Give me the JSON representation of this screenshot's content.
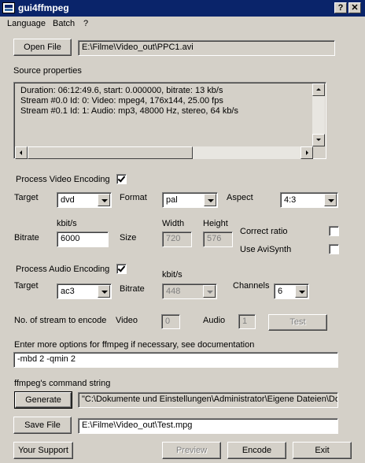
{
  "window": {
    "title": "gui4ffmpeg",
    "help_glyph": "?",
    "close_glyph": "✕"
  },
  "menu": {
    "items": [
      "Language",
      "Batch",
      "?"
    ]
  },
  "input": {
    "open_label": "Open File",
    "path": "E:\\Filme\\Video_out\\PPC1.avi"
  },
  "source": {
    "heading": "Source properties",
    "lines": [
      "Duration: 06:12:49.6, start: 0.000000, bitrate: 13 kb/s",
      "Stream #0.0  Id:   0: Video: mpeg4, 176x144, 25.00 fps",
      "Stream #0.1  Id:   1: Audio: mp3, 48000 Hz, stereo, 64 kb/s"
    ]
  },
  "video": {
    "process_label": "Process Video Encoding",
    "process_checked": true,
    "target_label": "Target",
    "target_value": "dvd",
    "format_label": "Format",
    "format_value": "pal",
    "aspect_label": "Aspect",
    "aspect_value": "4:3",
    "kbits_label": "kbit/s",
    "bitrate_label": "Bitrate",
    "bitrate_value": "6000",
    "size_label": "Size",
    "width_label": "Width",
    "width_value": "720",
    "height_label": "Height",
    "height_value": "576",
    "correct_ratio_label": "Correct ratio",
    "correct_ratio_checked": false,
    "avisynth_label": "Use AviSynth",
    "avisynth_checked": false
  },
  "audio": {
    "process_label": "Process Audio Encoding",
    "process_checked": true,
    "target_label": "Target",
    "target_value": "ac3",
    "kbits_label": "kbit/s",
    "bitrate_label": "Bitrate",
    "bitrate_value": "448",
    "channels_label": "Channels",
    "channels_value": "6"
  },
  "streams": {
    "label": "No. of stream to encode",
    "video_label": "Video",
    "video_value": "0",
    "audio_label": "Audio",
    "audio_value": "1",
    "test_label": "Test"
  },
  "options": {
    "label": "Enter more options for ffmpeg if necessary, see documentation",
    "value": "-mbd 2 -qmin 2"
  },
  "command": {
    "label": "ffmpeg's command string",
    "generate_label": "Generate",
    "value": "\"C:\\Dokumente und Einstellungen\\Administrator\\Eigene Dateien\\Do"
  },
  "output": {
    "save_label": "Save File",
    "path": "E:\\Filme\\Video_out\\Test.mpg"
  },
  "footer": {
    "support_label": "Your Support",
    "preview_label": "Preview",
    "encode_label": "Encode",
    "exit_label": "Exit"
  }
}
